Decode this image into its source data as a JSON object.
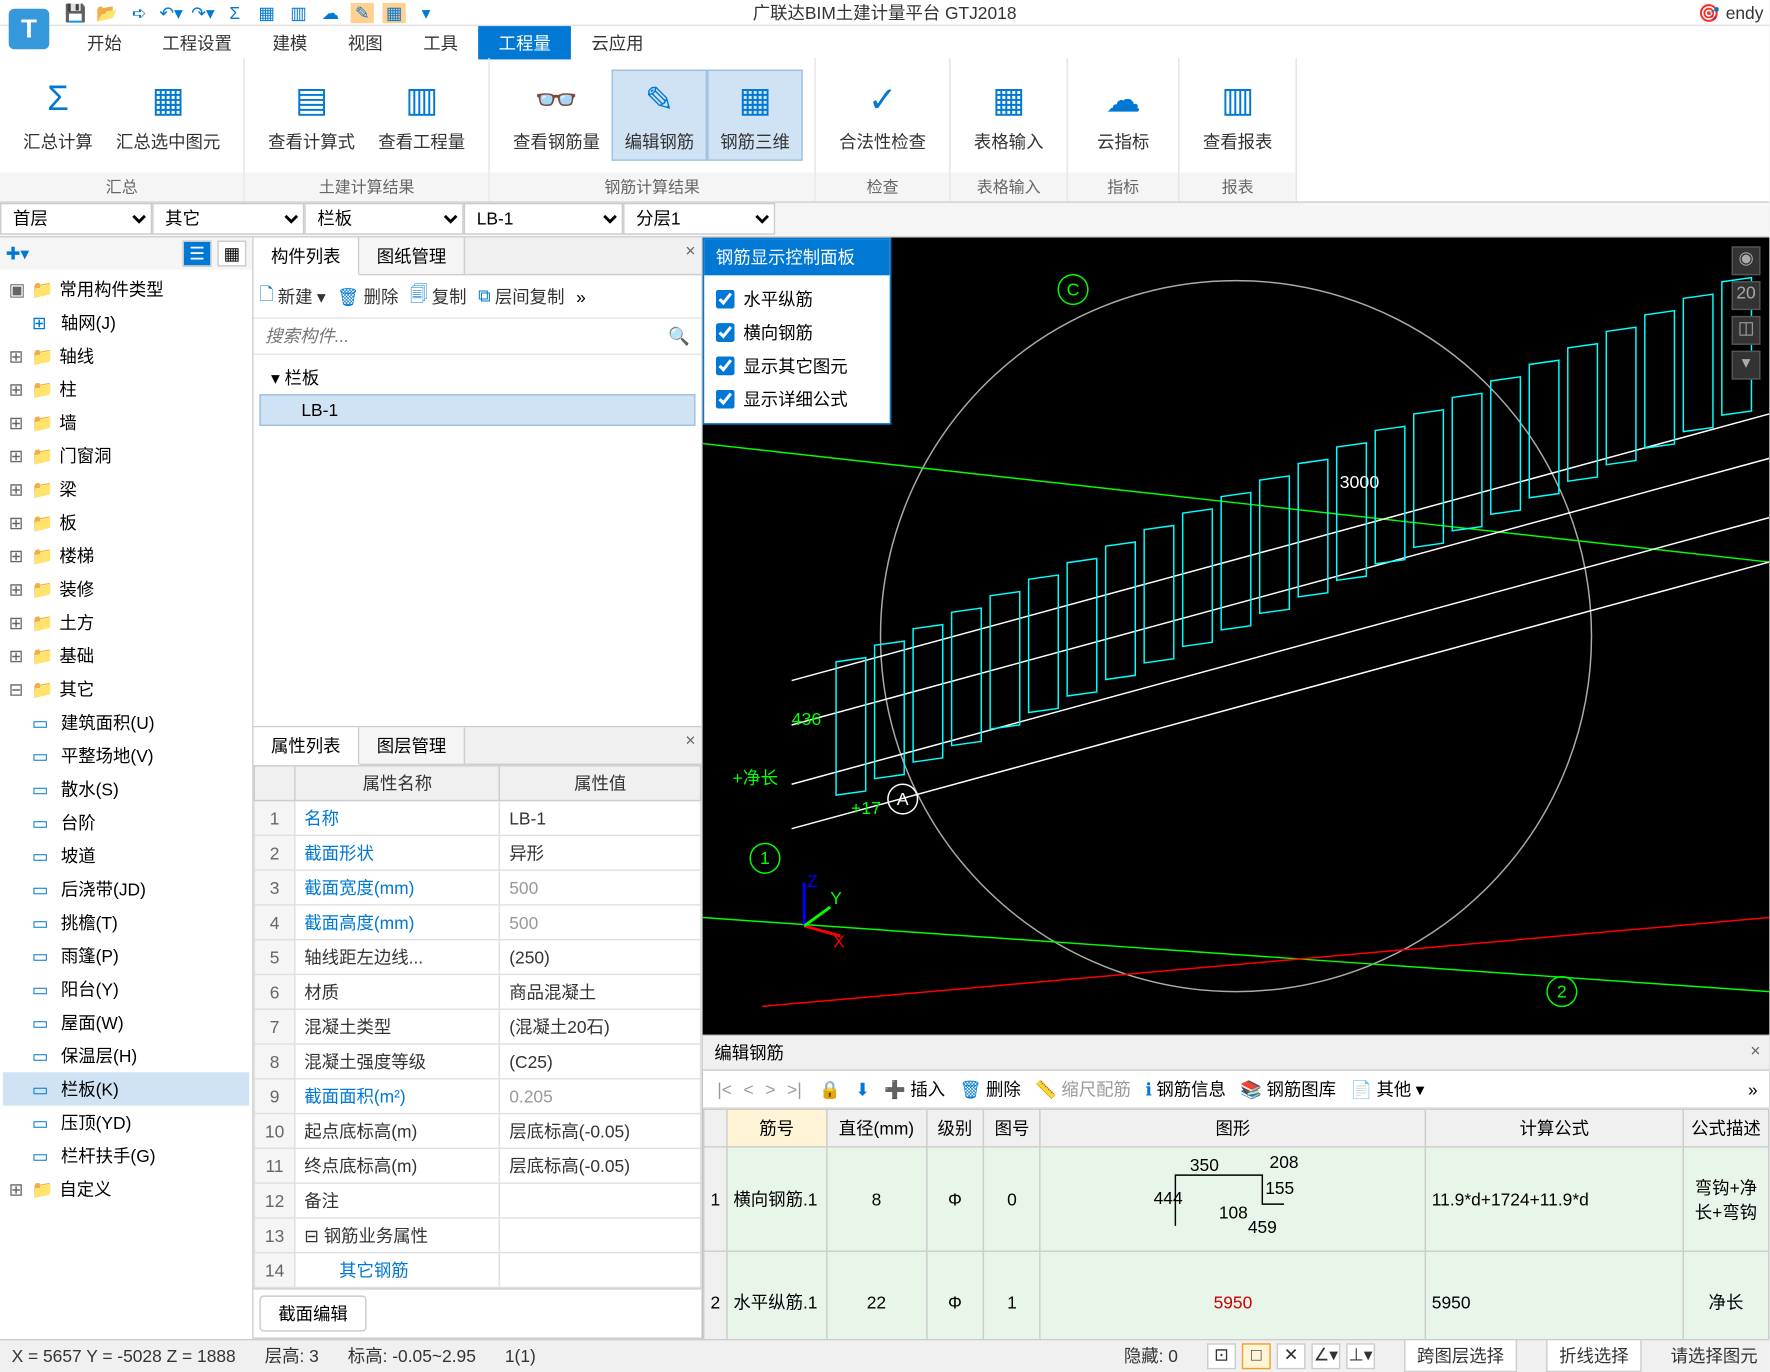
{
  "app": {
    "title": "广联达BIM土建计量平台 GTJ2018",
    "user": "endy"
  },
  "menu": {
    "items": [
      "开始",
      "工程设置",
      "建模",
      "视图",
      "工具",
      "工程量",
      "云应用"
    ],
    "active_index": 5
  },
  "ribbon": {
    "groups": [
      {
        "title": "汇总",
        "buttons": [
          {
            "label": "汇总计算",
            "icon": "Σ"
          },
          {
            "label": "汇总选中图元",
            "icon": "▦"
          }
        ]
      },
      {
        "title": "土建计算结果",
        "buttons": [
          {
            "label": "查看计算式",
            "icon": "▤"
          },
          {
            "label": "查看工程量",
            "icon": "▥"
          }
        ]
      },
      {
        "title": "钢筋计算结果",
        "buttons": [
          {
            "label": "查看钢筋量",
            "icon": "👓"
          },
          {
            "label": "编辑钢筋",
            "icon": "✎",
            "active": true
          },
          {
            "label": "钢筋三维",
            "icon": "▦",
            "active": true
          }
        ]
      },
      {
        "title": "检查",
        "buttons": [
          {
            "label": "合法性检查",
            "icon": "✓"
          }
        ]
      },
      {
        "title": "表格输入",
        "buttons": [
          {
            "label": "表格输入",
            "icon": "▦"
          }
        ]
      },
      {
        "title": "指标",
        "buttons": [
          {
            "label": "云指标",
            "icon": "☁"
          }
        ]
      },
      {
        "title": "报表",
        "buttons": [
          {
            "label": "查看报表",
            "icon": "▥"
          }
        ]
      }
    ]
  },
  "selectors": {
    "floor": "首层",
    "category": "其它",
    "type": "栏板",
    "component": "LB-1",
    "layer": "分层1"
  },
  "nav_tree": {
    "title": "常用构件类型",
    "items": [
      {
        "label": "轴网(J)",
        "icon": "grid",
        "level": 1
      },
      {
        "label": "轴线",
        "icon": "folder"
      },
      {
        "label": "柱",
        "icon": "folder"
      },
      {
        "label": "墙",
        "icon": "folder"
      },
      {
        "label": "门窗洞",
        "icon": "folder"
      },
      {
        "label": "梁",
        "icon": "folder"
      },
      {
        "label": "板",
        "icon": "folder"
      },
      {
        "label": "楼梯",
        "icon": "folder"
      },
      {
        "label": "装修",
        "icon": "folder"
      },
      {
        "label": "土方",
        "icon": "folder"
      },
      {
        "label": "基础",
        "icon": "folder"
      },
      {
        "label": "其它",
        "icon": "folder",
        "expanded": true,
        "children": [
          {
            "label": "建筑面积(U)",
            "icon": "area"
          },
          {
            "label": "平整场地(V)",
            "icon": "level"
          },
          {
            "label": "散水(S)",
            "icon": "water"
          },
          {
            "label": "台阶",
            "icon": "step"
          },
          {
            "label": "坡道",
            "icon": "ramp"
          },
          {
            "label": "后浇带(JD)",
            "icon": "strip"
          },
          {
            "label": "挑檐(T)",
            "icon": "eave"
          },
          {
            "label": "雨篷(P)",
            "icon": "canopy"
          },
          {
            "label": "阳台(Y)",
            "icon": "balcony"
          },
          {
            "label": "屋面(W)",
            "icon": "roof"
          },
          {
            "label": "保温层(H)",
            "icon": "insul"
          },
          {
            "label": "栏板(K)",
            "icon": "rail",
            "selected": true
          },
          {
            "label": "压顶(YD)",
            "icon": "cap"
          },
          {
            "label": "栏杆扶手(G)",
            "icon": "hand"
          }
        ]
      },
      {
        "label": "自定义",
        "icon": "folder"
      }
    ]
  },
  "component_list": {
    "tab1": "构件列表",
    "tab2": "图纸管理",
    "toolbar": {
      "new": "新建",
      "delete": "删除",
      "copy": "复制",
      "layer_copy": "层间复制"
    },
    "search_placeholder": "搜索构件...",
    "root": "栏板",
    "item": "LB-1"
  },
  "properties": {
    "tab1": "属性列表",
    "tab2": "图层管理",
    "header_name": "属性名称",
    "header_value": "属性值",
    "rows": [
      {
        "n": "1",
        "name": "名称",
        "value": "LB-1",
        "dark": true
      },
      {
        "n": "2",
        "name": "截面形状",
        "value": "异形",
        "dark": true
      },
      {
        "n": "3",
        "name": "截面宽度(mm)",
        "value": "500"
      },
      {
        "n": "4",
        "name": "截面高度(mm)",
        "value": "500"
      },
      {
        "n": "5",
        "name": "轴线距左边线...",
        "value": "(250)",
        "plain": true,
        "dark": true
      },
      {
        "n": "6",
        "name": "材质",
        "value": "商品混凝土",
        "plain": true,
        "dark": true
      },
      {
        "n": "7",
        "name": "混凝土类型",
        "value": "(混凝土20石)",
        "plain": true,
        "dark": true
      },
      {
        "n": "8",
        "name": "混凝土强度等级",
        "value": "(C25)",
        "plain": true,
        "dark": true
      },
      {
        "n": "9",
        "name": "截面面积(m²)",
        "value": "0.205"
      },
      {
        "n": "10",
        "name": "起点底标高(m)",
        "value": "层底标高(-0.05)",
        "plain": true,
        "dark": true
      },
      {
        "n": "11",
        "name": "终点底标高(m)",
        "value": "层底标高(-0.05)",
        "plain": true,
        "dark": true
      },
      {
        "n": "12",
        "name": "备注",
        "value": "",
        "plain": true
      },
      {
        "n": "13",
        "name": "⊟ 钢筋业务属性",
        "value": "",
        "plain": true
      },
      {
        "n": "14",
        "name": "　　其它钢筋",
        "value": ""
      }
    ],
    "footer_btn": "截面编辑"
  },
  "viewport_panel": {
    "title": "钢筋显示控制面板",
    "checks": [
      "水平纵筋",
      "横向钢筋",
      "显示其它图元",
      "显示详细公式"
    ]
  },
  "viewport_labels": {
    "dim1": "3000",
    "grid_c": "C",
    "grid_a": "A",
    "grid_1": "1",
    "grid_2": "2",
    "num_436": "436",
    "text1": "+净长",
    "text2": "+17"
  },
  "rebar_editor": {
    "title": "编辑钢筋",
    "toolbar": {
      "insert": "插入",
      "delete": "删除",
      "ruler": "缩尺配筋",
      "info": "钢筋信息",
      "lib": "钢筋图库",
      "other": "其他"
    },
    "headers": [
      "筋号",
      "直径(mm)",
      "级别",
      "图号",
      "图形",
      "计算公式",
      "公式描述"
    ],
    "rows": [
      {
        "rn": "1",
        "name": "横向钢筋.1",
        "dia": "8",
        "grade": "Φ",
        "fig": "0",
        "shape_nums": [
          "208",
          "350",
          "155",
          "444",
          "108",
          "459"
        ],
        "formula": "11.9*d+1724+11.9*d",
        "desc": "弯钩+净长+弯钩"
      },
      {
        "rn": "2",
        "name": "水平纵筋.1",
        "dia": "22",
        "grade": "Φ",
        "fig": "1",
        "shape_text": "5950",
        "formula": "5950",
        "desc": "净长"
      }
    ]
  },
  "statusbar": {
    "coords": "X = 5657 Y = -5028 Z = 1888",
    "floor": "层高:   3",
    "elev": "标高: -0.05~2.95",
    "sel": "1(1)",
    "hidden": "隐藏:   0",
    "btn1": "跨图层选择",
    "btn2": "折线选择",
    "prompt": "请选择图元"
  }
}
